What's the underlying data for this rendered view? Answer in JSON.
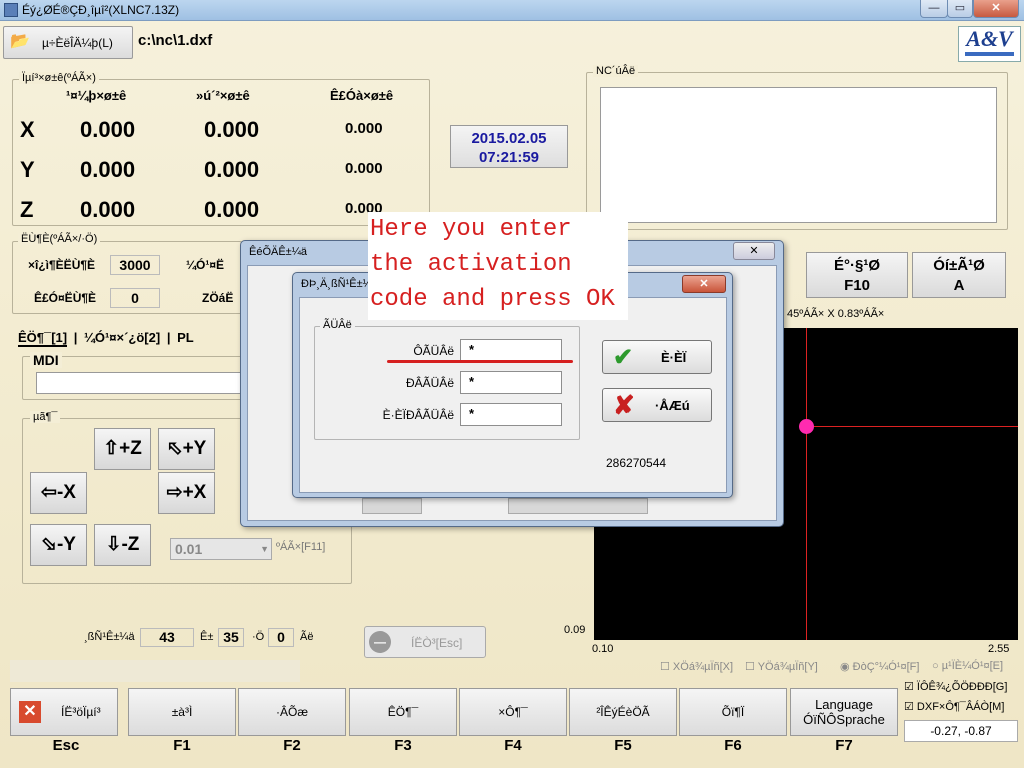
{
  "window": {
    "title": "Éý¿ØÉ®ÇÐ¸îµî²(XLNC7.13Z)",
    "min_label": "—",
    "max_label": "▭",
    "close_label": "✕"
  },
  "toolbar": {
    "load_label": "µ÷ÈëÎÄ¼þ(L)",
    "file_path": "c:\\nc\\1.dxf",
    "logo": "A&V"
  },
  "coords": {
    "group_label": "Ïµí³×ø±ê(ºÁÃ×)",
    "headers": [
      "¹¤¼þ×ø±ê",
      "»ú´²×ø±ê",
      "Ê£Óà×ø±ê"
    ],
    "rows": [
      {
        "axis": "X",
        "work": "0.000",
        "machine": "0.000",
        "remain": "0.000"
      },
      {
        "axis": "Y",
        "work": "0.000",
        "machine": "0.000",
        "remain": "0.000"
      },
      {
        "axis": "Z",
        "work": "0.000",
        "machine": "0.000",
        "remain": "0.000"
      }
    ]
  },
  "datetime": {
    "date": "2015.02.05",
    "time": "07:21:59"
  },
  "nc": {
    "label": "NC´úÂë"
  },
  "speed": {
    "label": "ËÙ¶È(ºÁÃ×/·Ö)",
    "row1_label": "×î¿ì¶ÈËÙ¶È",
    "row1_value": "3000",
    "row2_label": "Ê£Ó¤ËÙ¶È",
    "row2_value": "0",
    "col2_a": "¼Ó¹¤Ë",
    "col2_b": "ZÖáË"
  },
  "tabs": [
    "ÊÖ¶¯[1]",
    "¼Ó¹¤×´¿ö[2]",
    "PL"
  ],
  "mdi": {
    "label": "MDI"
  },
  "jog_group": {
    "label": "µã¶¯"
  },
  "jog": {
    "plus_z": "+Z",
    "plus_y": "+Y",
    "minus_x": "-X",
    "plus_x": "+X",
    "minus_y": "-Y",
    "minus_z": "-Z"
  },
  "step": {
    "value": "0.01",
    "label": "ºÁÃ×[F11]"
  },
  "right_keys": {
    "f10_label": "É°·§¹Ø",
    "f10_key": "F10",
    "a_label": "Óí±Ã¹Ø",
    "a_key": "A"
  },
  "view": {
    "size_label": "45ºÁÃ× X 0.83ºÁÃ×",
    "x_min": "0.10",
    "x_max": "2.55",
    "y_val": "0.09",
    "point_x": 0.1,
    "point_y": 0.09
  },
  "status": {
    "label1": "¸ßÑ¹Ê±¼ä",
    "val1": "43",
    "label2": "Ê±",
    "val2": "35",
    "label3": "·Ö",
    "val3": "0",
    "label4": "Ãë",
    "reset_label": "ÍËÒ³[Esc]"
  },
  "options": {
    "x_mirror": "XÖá¾µÏñ[X]",
    "y_mirror": "YÖá¾µÏñ[Y]",
    "rotate": "ÐòÇ°¼Ó¹¤[F]",
    "reverse": "µ¹ÏÈ¼Ó¹¤[E]",
    "auto_snap": "ÏÔÊ¾¿ÕÖÐÐÐ[G]",
    "dxf": "DXF×Ô¶¯ÂÁÒ[M]",
    "coords": "-0.27,  -0.87"
  },
  "fkeys": [
    {
      "label": "ÍË³öÏµí³",
      "key": "Esc"
    },
    {
      "label": "±à³Ì",
      "key": "F1"
    },
    {
      "label": "·ÂÕæ",
      "key": "F2"
    },
    {
      "label": "ÊÖ¶¯",
      "key": "F3"
    },
    {
      "label": "×Ô¶¯",
      "key": "F4"
    },
    {
      "label": "²ÎÊýÉèÖÃ",
      "key": "F5"
    },
    {
      "label": "Õï¶Ï",
      "key": "F6"
    },
    {
      "label": "Language\nÓïÑÔSprache",
      "key": "F7"
    }
  ],
  "back_dialog": {
    "title": "ÊéÕÄÊ±¼ä",
    "close": "✕"
  },
  "dialog": {
    "title": "ÐÞ¸Ä¸ßÑ¹Ê±¼ä",
    "close": "✕",
    "group_label": "ÃÜÂë",
    "field1_label": "Ô­ÃÜÂë",
    "field1_value": "*",
    "field2_label": "ÐÂÃÜÂë",
    "field2_value": "*",
    "field3_label": "È·ÈÏÐÂÃÜÂë",
    "field3_value": "*",
    "ok_label": "È·ÈÏ",
    "cancel_label": "·ÅÆú",
    "code": "286270544"
  },
  "annotation": {
    "line1": "Here you enter",
    "line2": "the activation",
    "line3": "code and press OK"
  }
}
